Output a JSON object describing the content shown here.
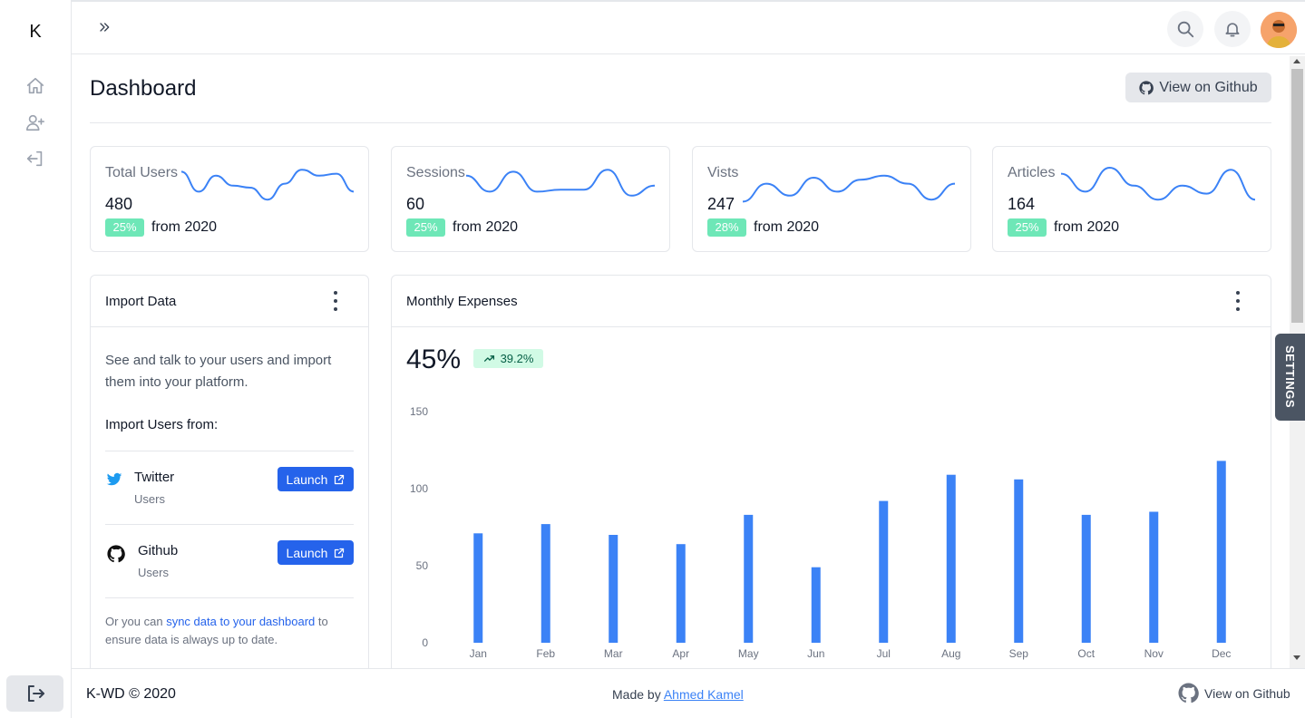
{
  "app": {
    "logo": "K"
  },
  "sidebar": {
    "items": [
      {
        "icon": "home-icon"
      },
      {
        "icon": "user-plus-icon"
      },
      {
        "icon": "login-icon"
      }
    ],
    "logout_icon": "logout-icon"
  },
  "header": {
    "expand_icon": "double-chevron-right-icon",
    "search_icon": "search-icon",
    "notification_icon": "bell-icon"
  },
  "page": {
    "title": "Dashboard",
    "github_button": "View on Github"
  },
  "stats": [
    {
      "label": "Total Users",
      "value": "480",
      "badge": "25%",
      "from": "from 2020",
      "trend": [
        0.9,
        0.4,
        0.8,
        0.55,
        0.5,
        0.2,
        0.6,
        0.95,
        0.8,
        0.85,
        0.4
      ]
    },
    {
      "label": "Sessions",
      "value": "60",
      "badge": "25%",
      "from": "from 2020",
      "trend": [
        0.8,
        0.4,
        0.9,
        0.4,
        0.45,
        0.45,
        0.95,
        0.3,
        0.55
      ]
    },
    {
      "label": "Vists",
      "value": "247",
      "badge": "28%",
      "from": "from 2020",
      "trend": [
        0.15,
        0.6,
        0.3,
        0.75,
        0.4,
        0.7,
        0.8,
        0.6,
        0.2,
        0.6
      ]
    },
    {
      "label": "Articles",
      "value": "164",
      "badge": "25%",
      "from": "from 2020",
      "trend": [
        0.85,
        0.4,
        1.0,
        0.55,
        0.2,
        0.55,
        0.35,
        0.95,
        0.2
      ]
    }
  ],
  "import_card": {
    "title": "Import Data",
    "description": "See and talk to your users and import them into your platform.",
    "subtitle": "Import Users from:",
    "sources": [
      {
        "name": "Twitter",
        "sub": "Users",
        "button": "Launch",
        "icon": "twitter-icon"
      },
      {
        "name": "Github",
        "sub": "Users",
        "button": "Launch",
        "icon": "github-icon"
      }
    ],
    "footnote_pre": "Or you can ",
    "footnote_link": "sync data to your dashboard",
    "footnote_post": " to ensure data is always up to date."
  },
  "expenses_card": {
    "title": "Monthly Expenses",
    "percent": "45%",
    "trend_value": "39.2%",
    "trend_icon": "trend-up-icon"
  },
  "chart_data": {
    "type": "bar",
    "title": "",
    "xlabel": "",
    "ylabel": "",
    "categories": [
      "Jan",
      "Feb",
      "Mar",
      "Apr",
      "May",
      "Jun",
      "Jul",
      "Aug",
      "Sep",
      "Oct",
      "Nov",
      "Dec"
    ],
    "values": [
      71,
      77,
      70,
      64,
      83,
      49,
      92,
      109,
      106,
      83,
      85,
      118
    ],
    "ylim": [
      0,
      150
    ],
    "yticks": [
      0,
      50,
      100,
      150
    ],
    "color": "#3b82f6",
    "grid": false
  },
  "settings_tab": "SETTINGS",
  "footer": {
    "copyright": "K-WD © 2020",
    "made_by": "Made by ",
    "author": "Ahmed Kamel",
    "github": "View on Github"
  },
  "colors": {
    "accent": "#2563eb",
    "badge": "#6ee7b7",
    "sparkline": "#3b82f6"
  }
}
